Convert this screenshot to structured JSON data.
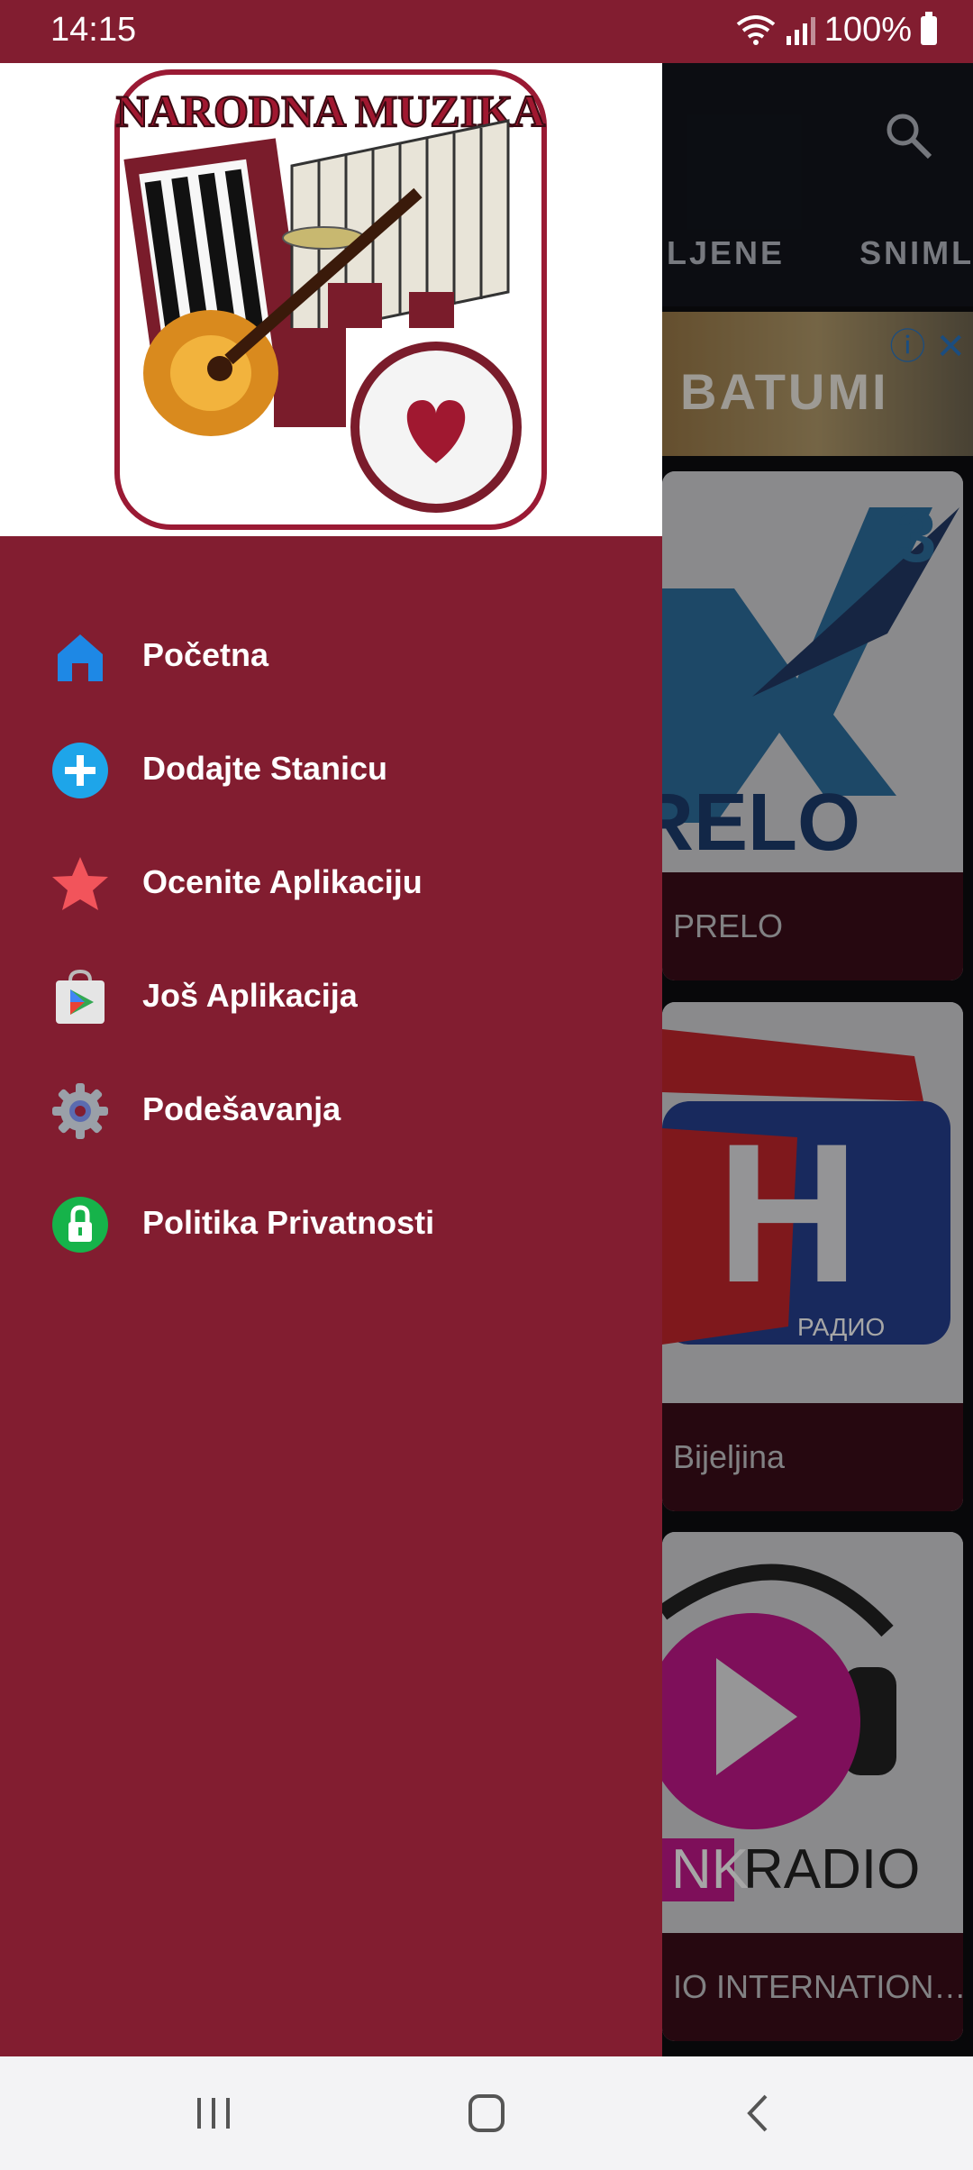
{
  "status_bar": {
    "time": "14:15",
    "battery": "100%"
  },
  "background_app": {
    "tabs": [
      "LJENE",
      "SNIMLJE"
    ],
    "ad": {
      "text": "BATUMI",
      "icons": "ⓘ ✕"
    },
    "cards": [
      {
        "label": "PRELO"
      },
      {
        "label": "Bijeljina"
      },
      {
        "label": "IO INTERNATION…"
      }
    ]
  },
  "drawer": {
    "logo_text": "NARODNA MUZIKA",
    "menu": [
      {
        "label": "Početna",
        "icon": "home-icon"
      },
      {
        "label": "Dodajte Stanicu",
        "icon": "add-circle-icon"
      },
      {
        "label": "Ocenite Aplikaciju",
        "icon": "star-icon"
      },
      {
        "label": "Još Aplikacija",
        "icon": "play-store-icon"
      },
      {
        "label": "Podešavanja",
        "icon": "gear-icon"
      },
      {
        "label": "Politika Privatnosti",
        "icon": "lock-icon"
      }
    ]
  },
  "colors": {
    "drawer": "#821d30",
    "status_bar": "#821d30"
  }
}
